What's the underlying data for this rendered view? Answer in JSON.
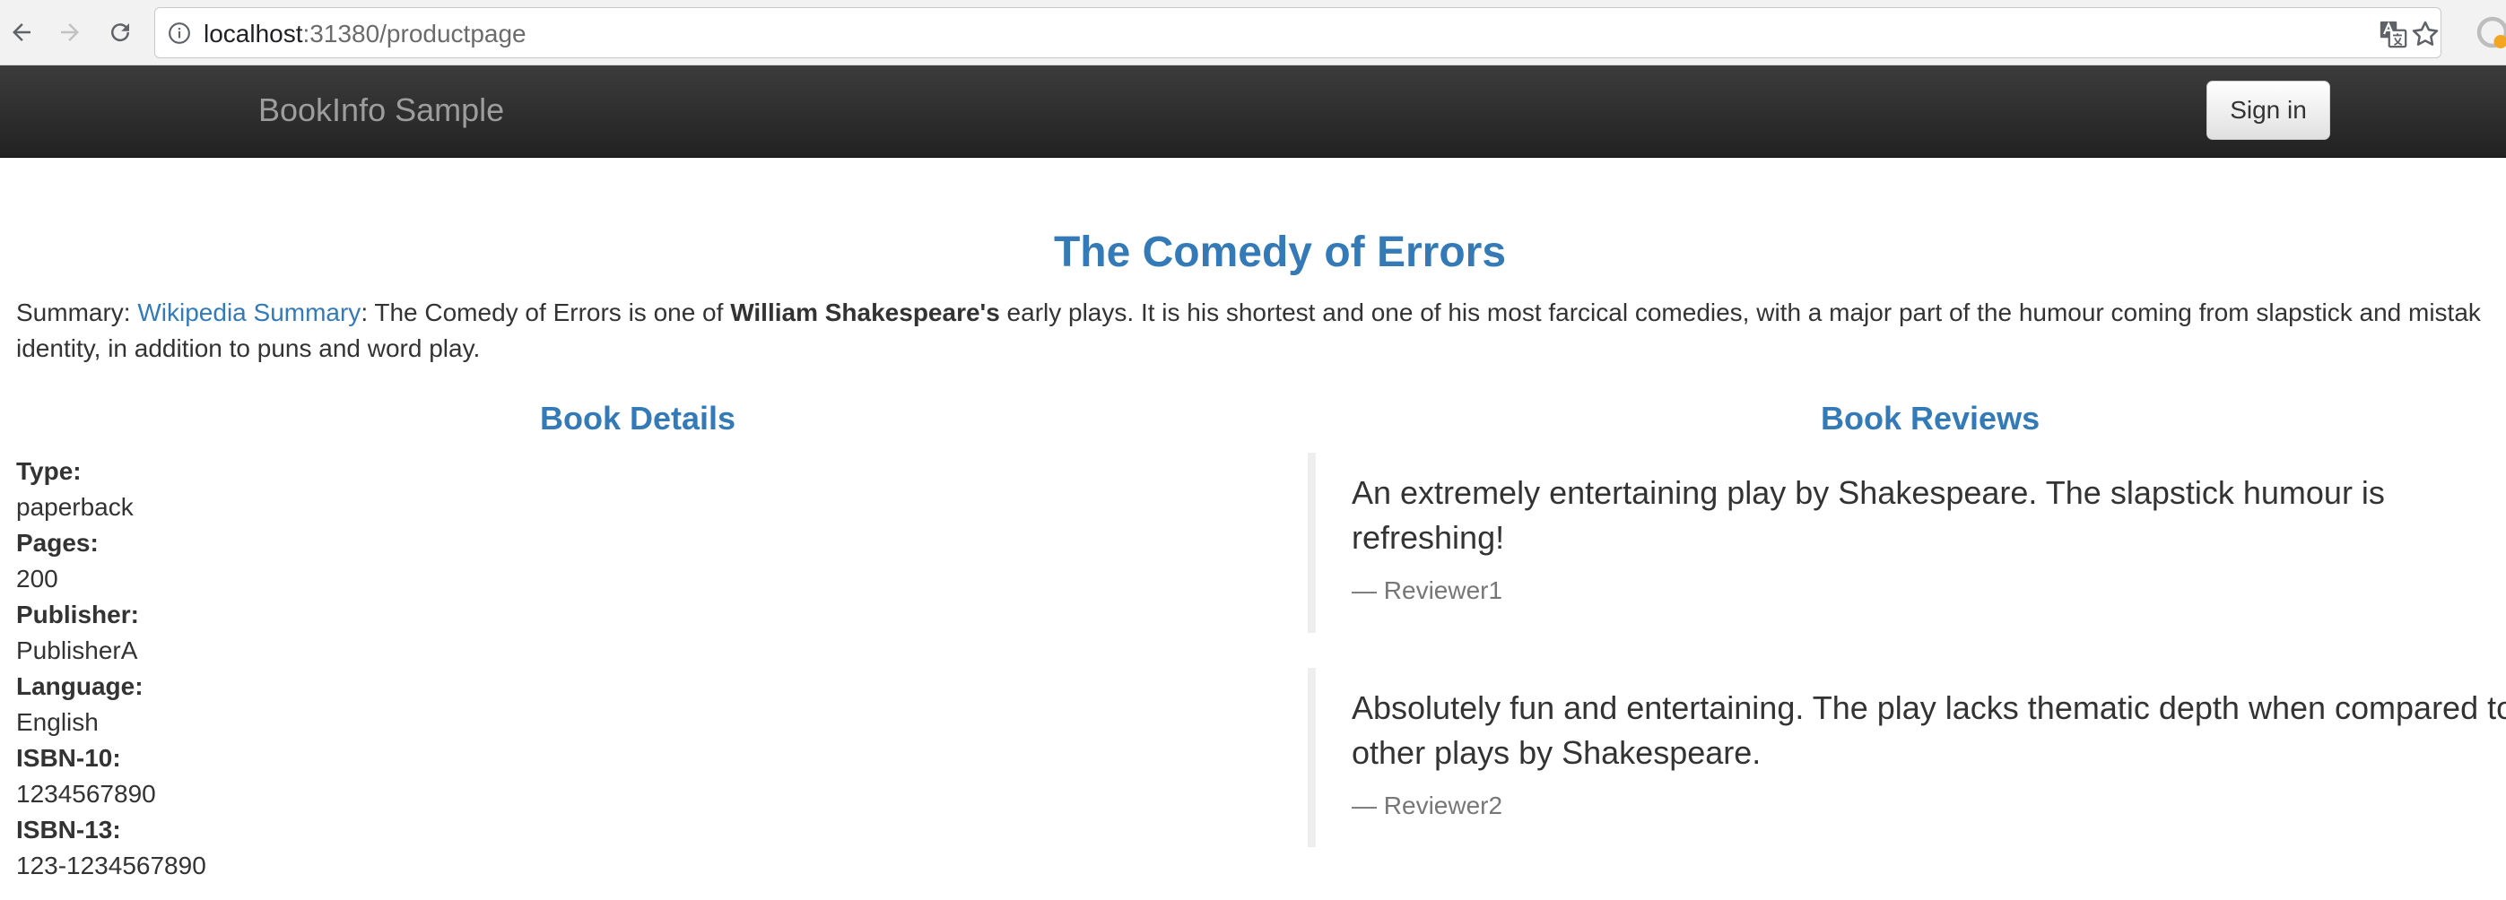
{
  "browser": {
    "url_host": "localhost",
    "url_path": ":31380/productpage"
  },
  "navbar": {
    "brand": "BookInfo Sample",
    "signin_label": "Sign in"
  },
  "product": {
    "title": "The Comedy of Errors",
    "summary_prefix": "Summary: ",
    "summary_link": "Wikipedia Summary",
    "summary_text_1": ": The Comedy of Errors is one of ",
    "summary_bold": "William Shakespeare's",
    "summary_text_2": " early plays. It is his shortest and one of his most farcical comedies, with a major part of the humour coming from slapstick and mistak",
    "summary_line2": "identity, in addition to puns and word play."
  },
  "details": {
    "heading": "Book Details",
    "items": [
      {
        "label": "Type:",
        "value": "paperback"
      },
      {
        "label": "Pages:",
        "value": "200"
      },
      {
        "label": "Publisher:",
        "value": "PublisherA"
      },
      {
        "label": "Language:",
        "value": "English"
      },
      {
        "label": "ISBN-10:",
        "value": "1234567890"
      },
      {
        "label": "ISBN-13:",
        "value": "123-1234567890"
      }
    ]
  },
  "reviews": {
    "heading": "Book Reviews",
    "items": [
      {
        "line1": "An extremely entertaining play by Shakespeare. The slapstick humour is",
        "line2": "refreshing!",
        "author": "— Reviewer1"
      },
      {
        "line1": "Absolutely fun and entertaining. The play lacks thematic depth when compared to",
        "line2": "other plays by Shakespeare.",
        "author": "— Reviewer2"
      }
    ]
  },
  "icons": {
    "back": "arrow-left-icon",
    "forward": "arrow-right-icon",
    "reload": "reload-icon",
    "info": "info-circle-icon",
    "translate": "translate-icon",
    "bookmark": "star-icon",
    "extension": "extension-icon"
  }
}
